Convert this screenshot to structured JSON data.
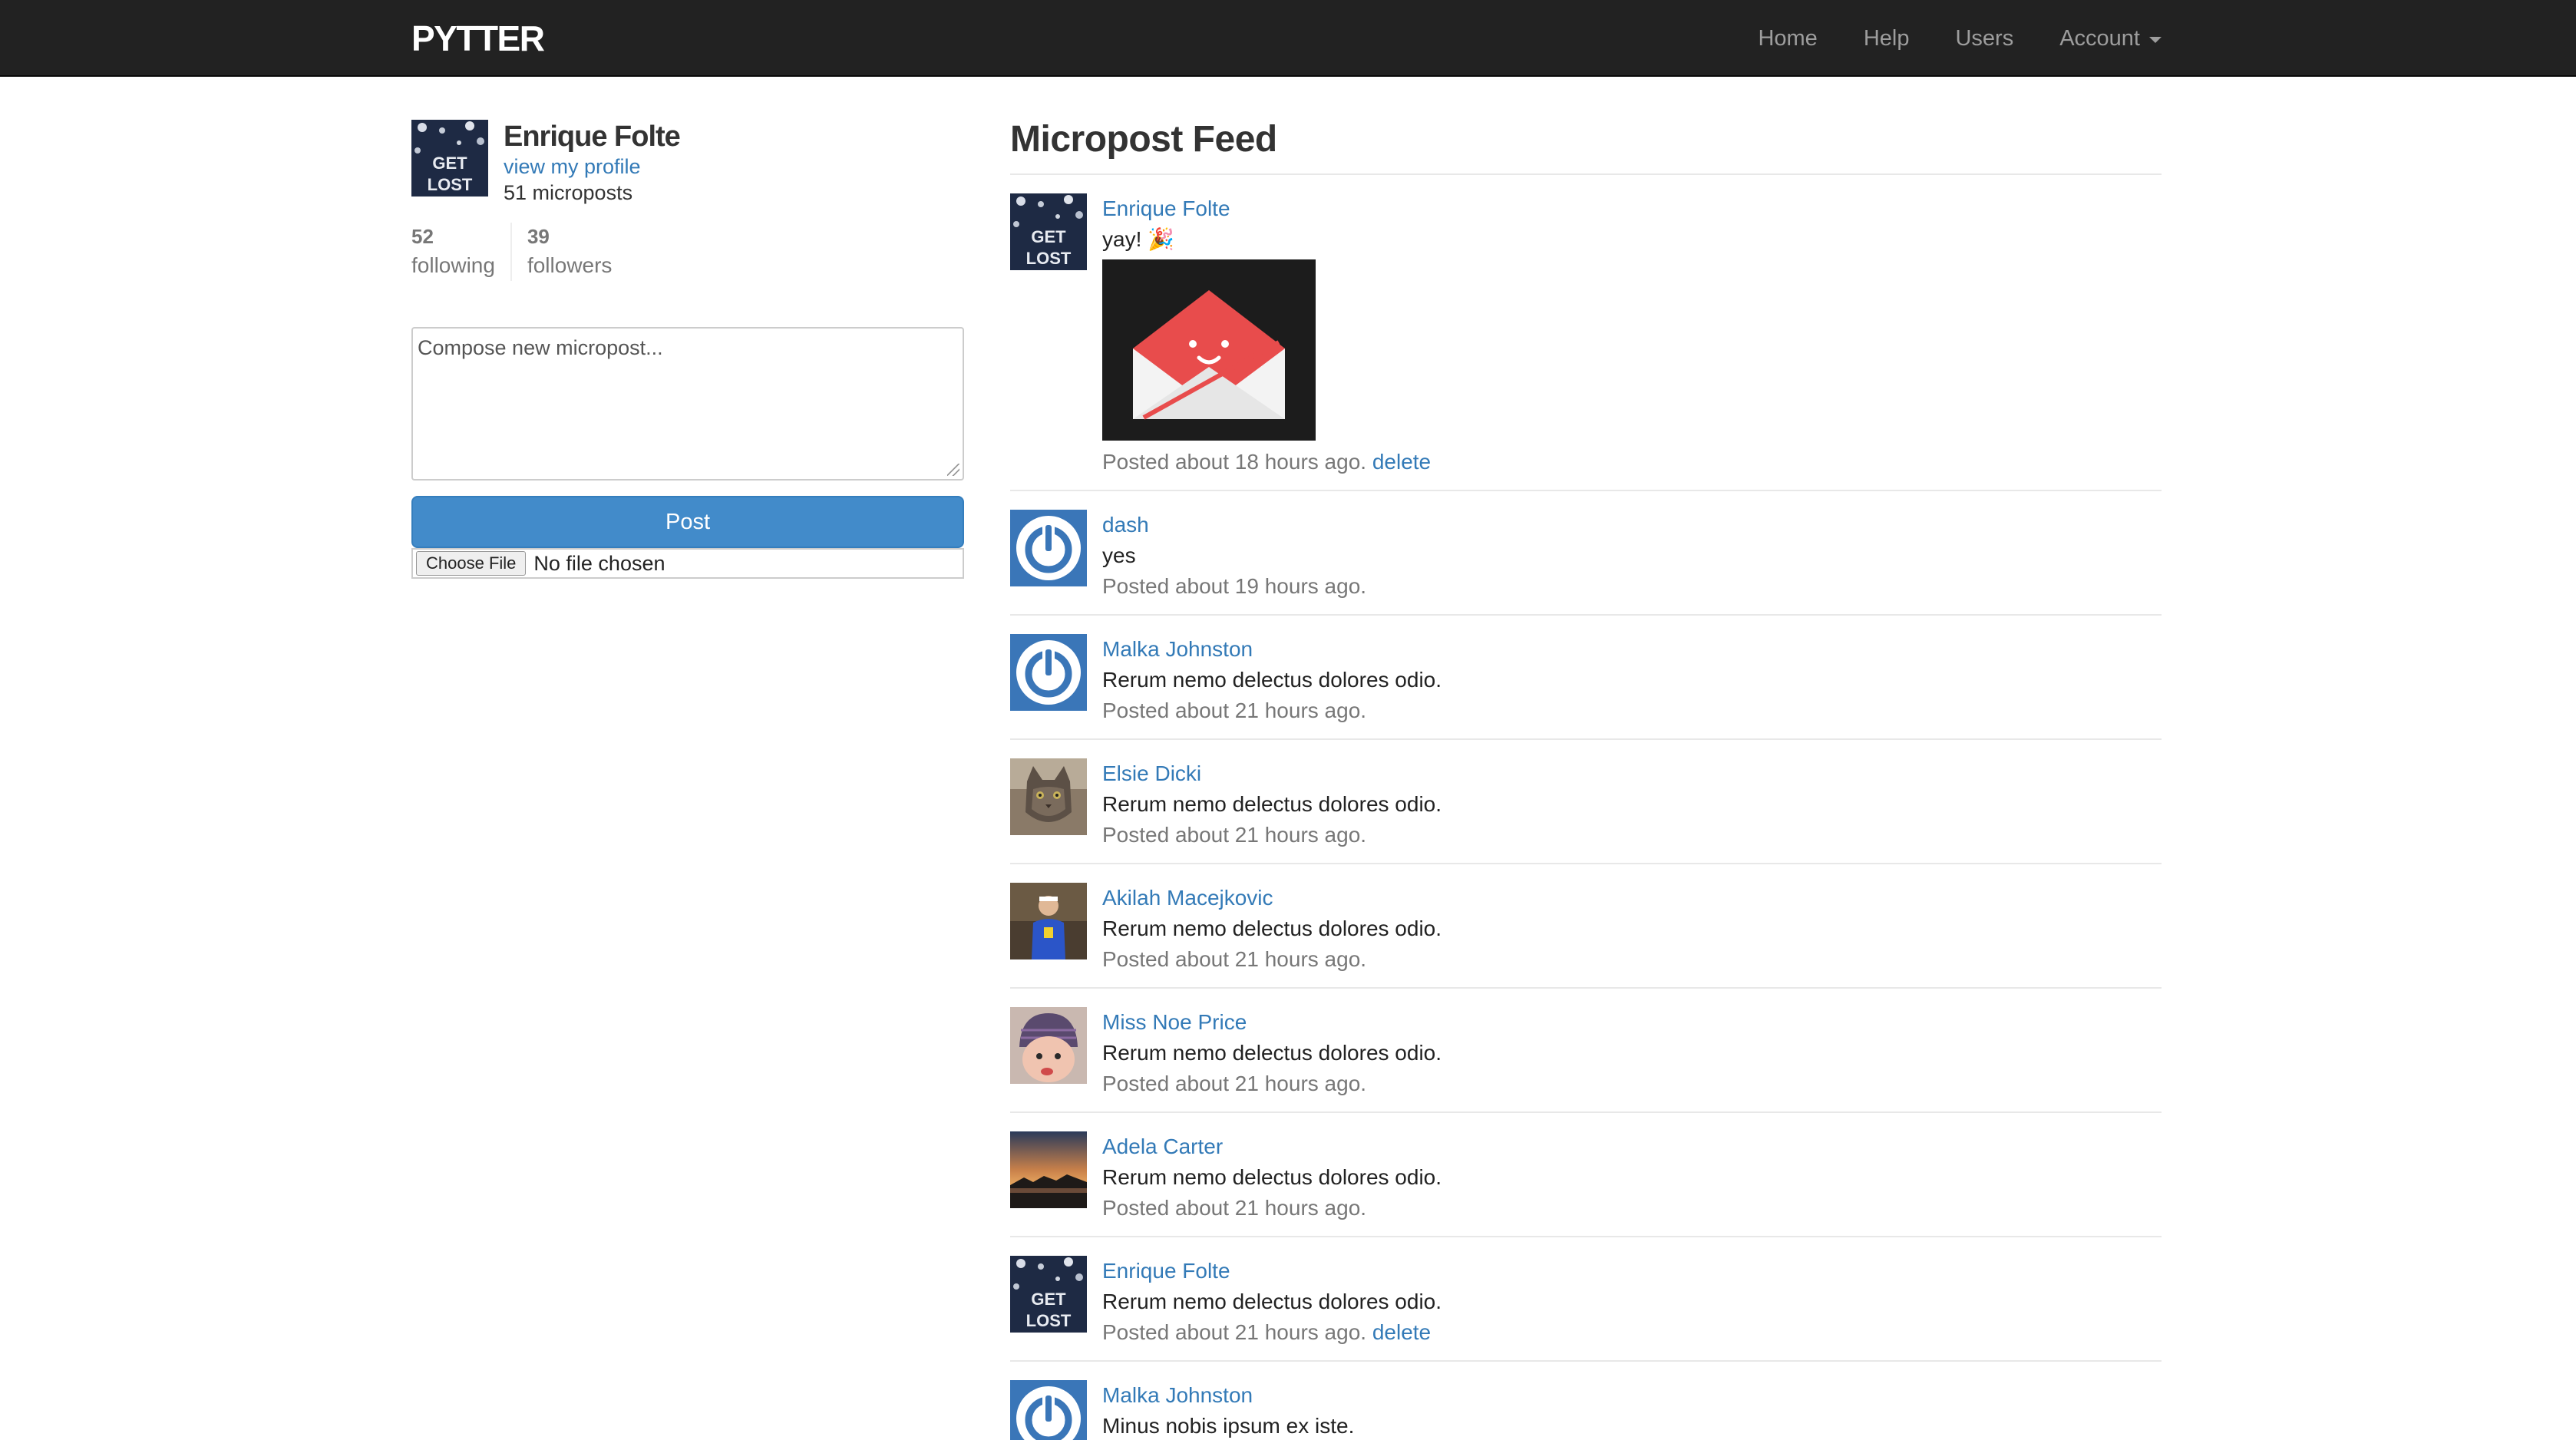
{
  "navbar": {
    "brand": "PYTTER",
    "links": {
      "home": "Home",
      "help": "Help",
      "users": "Users",
      "account": "Account"
    }
  },
  "sidebar": {
    "user_name": "Enrique Folte",
    "profile_link": "view my profile",
    "microposts_count": "51 microposts",
    "following_count": "52",
    "following_label": "following",
    "followers_count": "39",
    "followers_label": "followers",
    "compose_placeholder": "Compose new micropost...",
    "post_button": "Post",
    "choose_file": "Choose File",
    "file_status": "No file chosen"
  },
  "feed": {
    "title": "Micropost Feed",
    "posts": [
      {
        "user": "Enrique Folte",
        "content": "yay! 🎉",
        "time": "Posted about 18 hours ago.",
        "delete": "delete",
        "avatar": "get-lost-avatar",
        "has_image": true
      },
      {
        "user": "dash",
        "content": "yes",
        "time": "Posted about 19 hours ago.",
        "avatar": "power-avatar"
      },
      {
        "user": "Malka Johnston",
        "content": "Rerum nemo delectus dolores odio.",
        "time": "Posted about 21 hours ago.",
        "avatar": "power-avatar"
      },
      {
        "user": "Elsie Dicki",
        "content": "Rerum nemo delectus dolores odio.",
        "time": "Posted about 21 hours ago.",
        "avatar": "cat-avatar"
      },
      {
        "user": "Akilah Macejkovic",
        "content": "Rerum nemo delectus dolores odio.",
        "time": "Posted about 21 hours ago.",
        "avatar": "person-avatar"
      },
      {
        "user": "Miss Noe Price",
        "content": "Rerum nemo delectus dolores odio.",
        "time": "Posted about 21 hours ago.",
        "avatar": "baby-avatar"
      },
      {
        "user": "Adela Carter",
        "content": "Rerum nemo delectus dolores odio.",
        "time": "Posted about 21 hours ago.",
        "avatar": "sunset-avatar"
      },
      {
        "user": "Enrique Folte",
        "content": "Rerum nemo delectus dolores odio.",
        "time": "Posted about 21 hours ago.",
        "delete": "delete",
        "avatar": "get-lost-avatar"
      },
      {
        "user": "Malka Johnston",
        "content": "Minus nobis ipsum ex iste.",
        "time": "",
        "avatar": "power-avatar"
      }
    ]
  },
  "colors": {
    "navbar_bg": "#222222",
    "link": "#337ab7",
    "primary_button": "#428bca",
    "avatar_blue": "#3a76b8",
    "envelope_red": "#e84c4c"
  }
}
